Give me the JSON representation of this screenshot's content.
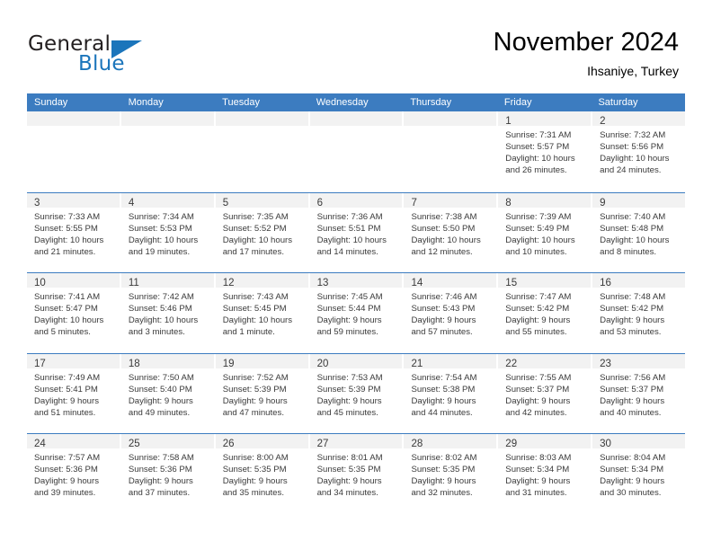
{
  "brand": {
    "name_part1": "General",
    "name_part2": "Blue",
    "accent_color": "#1b75bb"
  },
  "header": {
    "title": "November 2024",
    "subtitle": "Ihsaniye, Turkey"
  },
  "calendar": {
    "header_color": "#3c7cc0",
    "weekdays": [
      "Sunday",
      "Monday",
      "Tuesday",
      "Wednesday",
      "Thursday",
      "Friday",
      "Saturday"
    ],
    "weeks": [
      [
        {
          "day": "",
          "lines": []
        },
        {
          "day": "",
          "lines": []
        },
        {
          "day": "",
          "lines": []
        },
        {
          "day": "",
          "lines": []
        },
        {
          "day": "",
          "lines": []
        },
        {
          "day": "1",
          "lines": [
            "Sunrise: 7:31 AM",
            "Sunset: 5:57 PM",
            "Daylight: 10 hours",
            "and 26 minutes."
          ]
        },
        {
          "day": "2",
          "lines": [
            "Sunrise: 7:32 AM",
            "Sunset: 5:56 PM",
            "Daylight: 10 hours",
            "and 24 minutes."
          ]
        }
      ],
      [
        {
          "day": "3",
          "lines": [
            "Sunrise: 7:33 AM",
            "Sunset: 5:55 PM",
            "Daylight: 10 hours",
            "and 21 minutes."
          ]
        },
        {
          "day": "4",
          "lines": [
            "Sunrise: 7:34 AM",
            "Sunset: 5:53 PM",
            "Daylight: 10 hours",
            "and 19 minutes."
          ]
        },
        {
          "day": "5",
          "lines": [
            "Sunrise: 7:35 AM",
            "Sunset: 5:52 PM",
            "Daylight: 10 hours",
            "and 17 minutes."
          ]
        },
        {
          "day": "6",
          "lines": [
            "Sunrise: 7:36 AM",
            "Sunset: 5:51 PM",
            "Daylight: 10 hours",
            "and 14 minutes."
          ]
        },
        {
          "day": "7",
          "lines": [
            "Sunrise: 7:38 AM",
            "Sunset: 5:50 PM",
            "Daylight: 10 hours",
            "and 12 minutes."
          ]
        },
        {
          "day": "8",
          "lines": [
            "Sunrise: 7:39 AM",
            "Sunset: 5:49 PM",
            "Daylight: 10 hours",
            "and 10 minutes."
          ]
        },
        {
          "day": "9",
          "lines": [
            "Sunrise: 7:40 AM",
            "Sunset: 5:48 PM",
            "Daylight: 10 hours",
            "and 8 minutes."
          ]
        }
      ],
      [
        {
          "day": "10",
          "lines": [
            "Sunrise: 7:41 AM",
            "Sunset: 5:47 PM",
            "Daylight: 10 hours",
            "and 5 minutes."
          ]
        },
        {
          "day": "11",
          "lines": [
            "Sunrise: 7:42 AM",
            "Sunset: 5:46 PM",
            "Daylight: 10 hours",
            "and 3 minutes."
          ]
        },
        {
          "day": "12",
          "lines": [
            "Sunrise: 7:43 AM",
            "Sunset: 5:45 PM",
            "Daylight: 10 hours",
            "and 1 minute."
          ]
        },
        {
          "day": "13",
          "lines": [
            "Sunrise: 7:45 AM",
            "Sunset: 5:44 PM",
            "Daylight: 9 hours",
            "and 59 minutes."
          ]
        },
        {
          "day": "14",
          "lines": [
            "Sunrise: 7:46 AM",
            "Sunset: 5:43 PM",
            "Daylight: 9 hours",
            "and 57 minutes."
          ]
        },
        {
          "day": "15",
          "lines": [
            "Sunrise: 7:47 AM",
            "Sunset: 5:42 PM",
            "Daylight: 9 hours",
            "and 55 minutes."
          ]
        },
        {
          "day": "16",
          "lines": [
            "Sunrise: 7:48 AM",
            "Sunset: 5:42 PM",
            "Daylight: 9 hours",
            "and 53 minutes."
          ]
        }
      ],
      [
        {
          "day": "17",
          "lines": [
            "Sunrise: 7:49 AM",
            "Sunset: 5:41 PM",
            "Daylight: 9 hours",
            "and 51 minutes."
          ]
        },
        {
          "day": "18",
          "lines": [
            "Sunrise: 7:50 AM",
            "Sunset: 5:40 PM",
            "Daylight: 9 hours",
            "and 49 minutes."
          ]
        },
        {
          "day": "19",
          "lines": [
            "Sunrise: 7:52 AM",
            "Sunset: 5:39 PM",
            "Daylight: 9 hours",
            "and 47 minutes."
          ]
        },
        {
          "day": "20",
          "lines": [
            "Sunrise: 7:53 AM",
            "Sunset: 5:39 PM",
            "Daylight: 9 hours",
            "and 45 minutes."
          ]
        },
        {
          "day": "21",
          "lines": [
            "Sunrise: 7:54 AM",
            "Sunset: 5:38 PM",
            "Daylight: 9 hours",
            "and 44 minutes."
          ]
        },
        {
          "day": "22",
          "lines": [
            "Sunrise: 7:55 AM",
            "Sunset: 5:37 PM",
            "Daylight: 9 hours",
            "and 42 minutes."
          ]
        },
        {
          "day": "23",
          "lines": [
            "Sunrise: 7:56 AM",
            "Sunset: 5:37 PM",
            "Daylight: 9 hours",
            "and 40 minutes."
          ]
        }
      ],
      [
        {
          "day": "24",
          "lines": [
            "Sunrise: 7:57 AM",
            "Sunset: 5:36 PM",
            "Daylight: 9 hours",
            "and 39 minutes."
          ]
        },
        {
          "day": "25",
          "lines": [
            "Sunrise: 7:58 AM",
            "Sunset: 5:36 PM",
            "Daylight: 9 hours",
            "and 37 minutes."
          ]
        },
        {
          "day": "26",
          "lines": [
            "Sunrise: 8:00 AM",
            "Sunset: 5:35 PM",
            "Daylight: 9 hours",
            "and 35 minutes."
          ]
        },
        {
          "day": "27",
          "lines": [
            "Sunrise: 8:01 AM",
            "Sunset: 5:35 PM",
            "Daylight: 9 hours",
            "and 34 minutes."
          ]
        },
        {
          "day": "28",
          "lines": [
            "Sunrise: 8:02 AM",
            "Sunset: 5:35 PM",
            "Daylight: 9 hours",
            "and 32 minutes."
          ]
        },
        {
          "day": "29",
          "lines": [
            "Sunrise: 8:03 AM",
            "Sunset: 5:34 PM",
            "Daylight: 9 hours",
            "and 31 minutes."
          ]
        },
        {
          "day": "30",
          "lines": [
            "Sunrise: 8:04 AM",
            "Sunset: 5:34 PM",
            "Daylight: 9 hours",
            "and 30 minutes."
          ]
        }
      ]
    ]
  }
}
